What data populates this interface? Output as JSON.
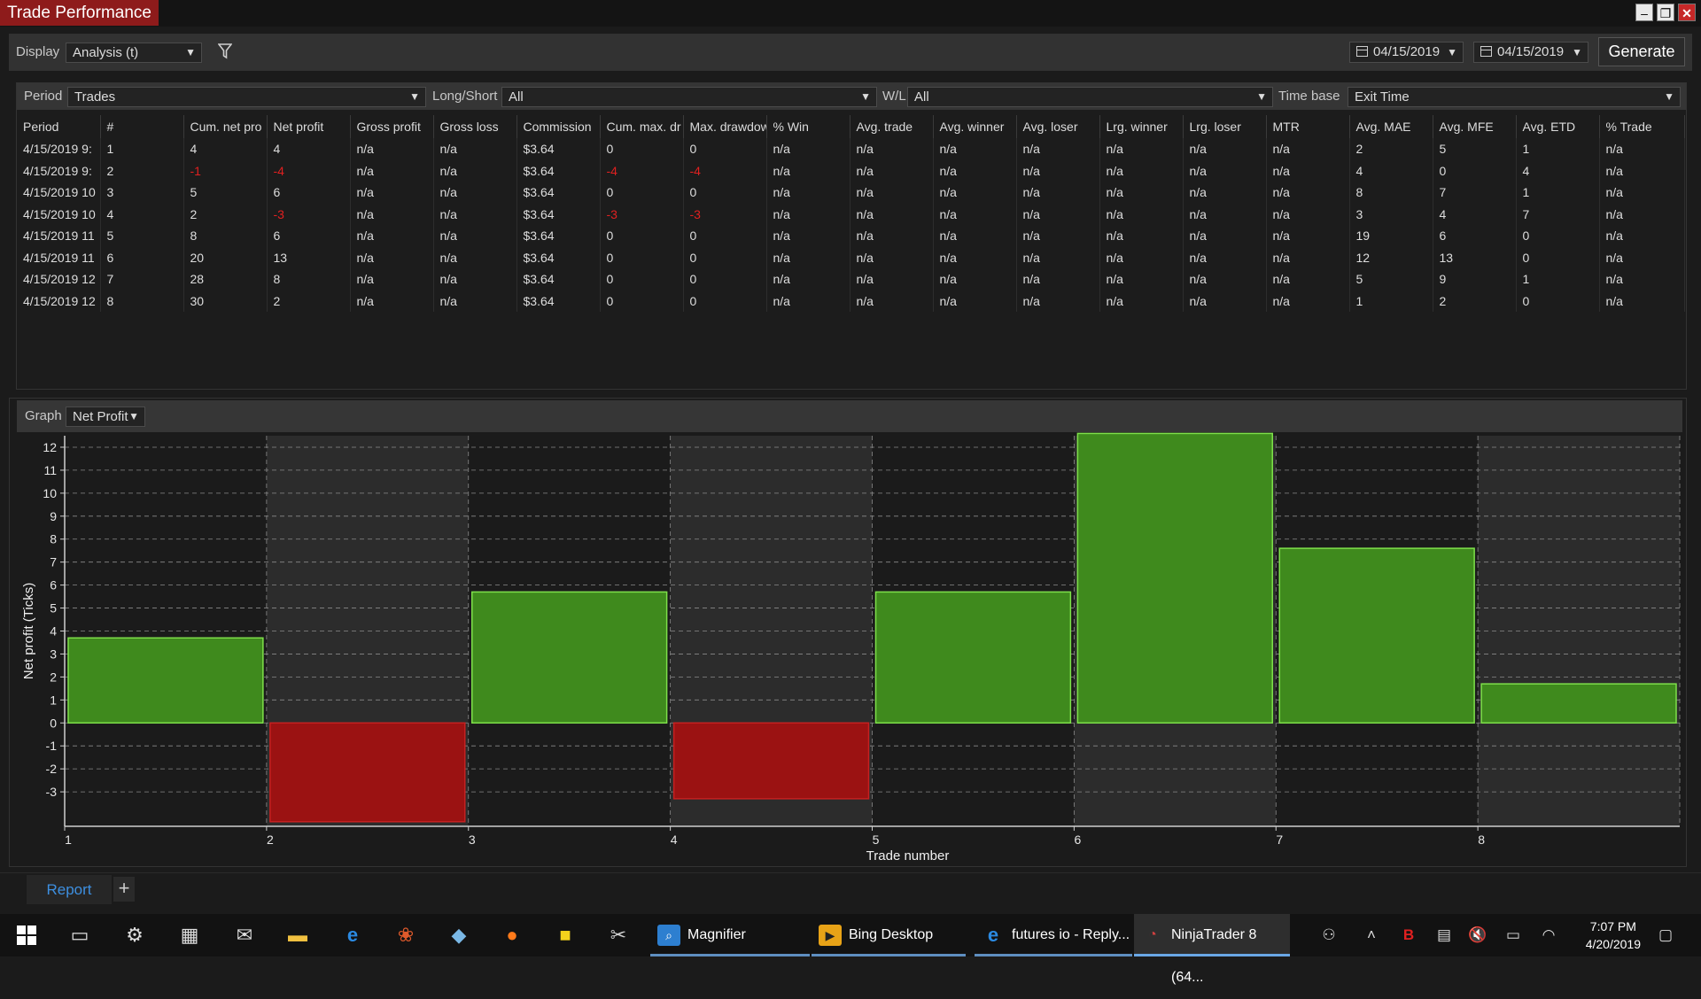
{
  "window": {
    "title": "Trade Performance"
  },
  "toolbar": {
    "display_label": "Display",
    "display_value": "Analysis (t)",
    "date_from": "04/15/2019",
    "date_to": "04/15/2019",
    "generate_label": "Generate"
  },
  "filters": {
    "period_label": "Period",
    "period_value": "Trades",
    "longshort_label": "Long/Short",
    "longshort_value": "All",
    "wl_label": "W/L",
    "wl_value": "All",
    "timebase_label": "Time base",
    "timebase_value": "Exit Time"
  },
  "table": {
    "columns": [
      "Period",
      "#",
      "Cum. net pro",
      "Net profit",
      "Gross profit",
      "Gross loss",
      "Commission",
      "Cum. max. dr",
      "Max. drawdow",
      "% Win",
      "Avg. trade",
      "Avg. winner",
      "Avg. loser",
      "Lrg. winner",
      "Lrg. loser",
      "MTR",
      "Avg. MAE",
      "Avg. MFE",
      "Avg. ETD",
      "% Trade"
    ],
    "rows": [
      [
        "4/15/2019 9:",
        "1",
        "4",
        "4",
        "n/a",
        "n/a",
        "$3.64",
        "0",
        "0",
        "n/a",
        "n/a",
        "n/a",
        "n/a",
        "n/a",
        "n/a",
        "n/a",
        "2",
        "5",
        "1",
        "n/a"
      ],
      [
        "4/15/2019 9:",
        "2",
        "-1",
        "-4",
        "n/a",
        "n/a",
        "$3.64",
        "-4",
        "-4",
        "n/a",
        "n/a",
        "n/a",
        "n/a",
        "n/a",
        "n/a",
        "n/a",
        "4",
        "0",
        "4",
        "n/a"
      ],
      [
        "4/15/2019 10",
        "3",
        "5",
        "6",
        "n/a",
        "n/a",
        "$3.64",
        "0",
        "0",
        "n/a",
        "n/a",
        "n/a",
        "n/a",
        "n/a",
        "n/a",
        "n/a",
        "8",
        "7",
        "1",
        "n/a"
      ],
      [
        "4/15/2019 10",
        "4",
        "2",
        "-3",
        "n/a",
        "n/a",
        "$3.64",
        "-3",
        "-3",
        "n/a",
        "n/a",
        "n/a",
        "n/a",
        "n/a",
        "n/a",
        "n/a",
        "3",
        "4",
        "7",
        "n/a"
      ],
      [
        "4/15/2019 11",
        "5",
        "8",
        "6",
        "n/a",
        "n/a",
        "$3.64",
        "0",
        "0",
        "n/a",
        "n/a",
        "n/a",
        "n/a",
        "n/a",
        "n/a",
        "n/a",
        "19",
        "6",
        "0",
        "n/a"
      ],
      [
        "4/15/2019 11",
        "6",
        "20",
        "13",
        "n/a",
        "n/a",
        "$3.64",
        "0",
        "0",
        "n/a",
        "n/a",
        "n/a",
        "n/a",
        "n/a",
        "n/a",
        "n/a",
        "12",
        "13",
        "0",
        "n/a"
      ],
      [
        "4/15/2019 12",
        "7",
        "28",
        "8",
        "n/a",
        "n/a",
        "$3.64",
        "0",
        "0",
        "n/a",
        "n/a",
        "n/a",
        "n/a",
        "n/a",
        "n/a",
        "n/a",
        "5",
        "9",
        "1",
        "n/a"
      ],
      [
        "4/15/2019 12",
        "8",
        "30",
        "2",
        "n/a",
        "n/a",
        "$3.64",
        "0",
        "0",
        "n/a",
        "n/a",
        "n/a",
        "n/a",
        "n/a",
        "n/a",
        "n/a",
        "1",
        "2",
        "0",
        "n/a"
      ]
    ]
  },
  "graph": {
    "label": "Graph",
    "selector_value": "Net Profit"
  },
  "chart_data": {
    "type": "bar",
    "categories": [
      "1",
      "2",
      "3",
      "4",
      "5",
      "6",
      "7",
      "8"
    ],
    "values": [
      3.7,
      -4.3,
      5.7,
      -3.3,
      5.7,
      12.6,
      7.6,
      1.7
    ],
    "xlabel": "Trade number",
    "ylabel": "Net profit (Ticks)",
    "yticks": [
      12,
      11,
      10,
      9,
      8,
      7,
      6,
      5,
      4,
      3,
      2,
      1,
      0,
      -1,
      -2,
      -3
    ],
    "ylim": [
      -4.5,
      12.5
    ],
    "grid": true,
    "colors": {
      "positive": "#3f8a1d",
      "positive_edge": "#7ee04a",
      "negative": "#9b1212",
      "negative_edge": "#c62020"
    }
  },
  "tabs": {
    "report_label": "Report",
    "add_label": "+"
  },
  "taskbar": {
    "apps": [
      {
        "label": "Magnifier"
      },
      {
        "label": "Bing Desktop"
      },
      {
        "label": "futures io - Reply..."
      },
      {
        "label": "NinjaTrader 8 (64..."
      }
    ],
    "time": "7:07 PM",
    "date": "4/20/2019"
  }
}
